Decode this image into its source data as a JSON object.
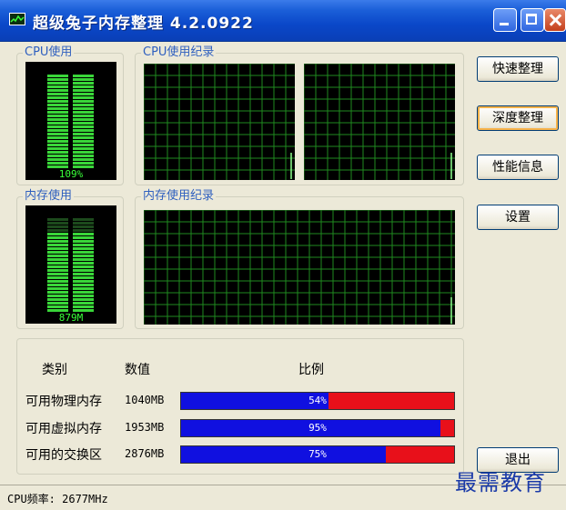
{
  "window": {
    "title": "超级兔子内存整理 4.2.0922"
  },
  "groups": {
    "cpu_usage": "CPU使用",
    "cpu_history": "CPU使用纪录",
    "mem_usage": "内存使用",
    "mem_history": "内存使用纪录"
  },
  "meters": {
    "cpu": {
      "text": "109%",
      "level": 1.0
    },
    "mem": {
      "text": "879M",
      "level": 0.85
    }
  },
  "buttons": {
    "quick": "快速整理",
    "deep": "深度整理",
    "perf": "性能信息",
    "settings": "设置",
    "exit": "退出"
  },
  "stats": {
    "headers": {
      "category": "类别",
      "value": "数值",
      "ratio": "比例"
    },
    "rows": [
      {
        "label": "可用物理内存",
        "value": "1040MB",
        "percent_text": "54%",
        "percent": 54
      },
      {
        "label": "可用虚拟内存",
        "value": "1953MB",
        "percent_text": "95%",
        "percent": 95
      },
      {
        "label": "可用的交换区",
        "value": "2876MB",
        "percent_text": "75%",
        "percent": 75
      }
    ]
  },
  "status": {
    "text": "CPU频率: 2677MHz"
  },
  "watermark": "最需教育",
  "colors": {
    "grid": "#1f8a1f",
    "meter_on": "#39d639",
    "meter_off": "#1c4a1c",
    "bar_used": "#1010e0",
    "bar_free": "#e8101a"
  }
}
